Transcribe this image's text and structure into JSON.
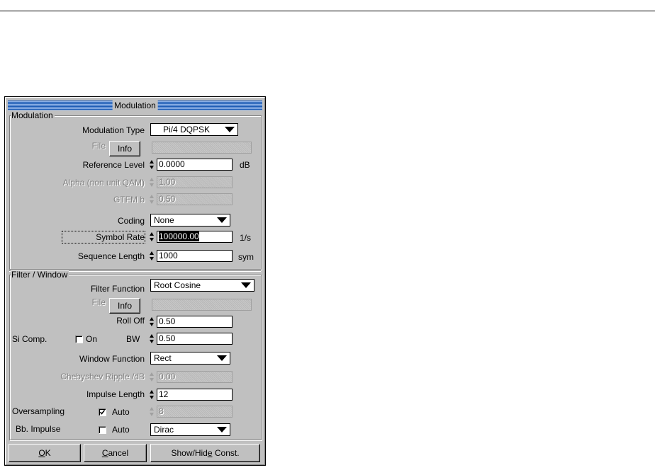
{
  "dialog": {
    "title": "Modulation",
    "modulation_group": {
      "label": "Modulation",
      "modulation_type": {
        "label": "Modulation Type",
        "value": "Pi/4 DQPSK"
      },
      "file": {
        "label": "File",
        "button": "Info",
        "value": ""
      },
      "reference_level": {
        "label": "Reference Level",
        "value": "0.0000",
        "unit": "dB"
      },
      "alpha": {
        "label": "Alpha (non unit QAM)",
        "value": "1.00"
      },
      "gtfm": {
        "label": "GTFM b",
        "value": "0.50"
      },
      "coding": {
        "label": "Coding",
        "value": "None"
      },
      "symbol_rate": {
        "label": "Symbol  Rate",
        "value": "100000.00",
        "unit": "1/s"
      },
      "sequence_length": {
        "label": "Sequence Length",
        "value": "1000",
        "unit": "sym"
      }
    },
    "filter_group": {
      "label": "Filter / Window",
      "filter_function": {
        "label": "Filter Function",
        "value": "Root Cosine"
      },
      "file": {
        "label": "File",
        "button": "Info",
        "value": ""
      },
      "roll_off": {
        "label": "Roll Off",
        "value": "0.50"
      },
      "si_comp": {
        "label": "Si Comp.",
        "on_label": "On",
        "on_checked": false,
        "bw_label": "BW",
        "bw_value": "0.50"
      },
      "window_function": {
        "label": "Window Function",
        "value": "Rect"
      },
      "chebyshev": {
        "label": "Chebyshev Ripple /dB",
        "value": "0.00"
      },
      "impulse_length": {
        "label": "Impulse Length",
        "value": "12"
      },
      "oversampling": {
        "label": "Oversampling",
        "auto_label": "Auto",
        "auto_checked": true,
        "value": "8"
      },
      "bb_impulse": {
        "label": "Bb. Impulse",
        "auto_label": "Auto",
        "auto_checked": false,
        "value": "Dirac"
      }
    },
    "buttons": {
      "ok": "OK",
      "ok_mnemonic": "O",
      "ok_rest": "K",
      "cancel": "Cancel",
      "cancel_mnemonic": "C",
      "cancel_rest": "ancel",
      "show_hide": "Show/Hide Const.",
      "show_hide_pre": "Show/Hid",
      "show_hide_mnemonic": "e",
      "show_hide_post": " Const."
    },
    "colors": {
      "titlebar": "#1e5db5",
      "face": "#c0c0c0"
    }
  }
}
